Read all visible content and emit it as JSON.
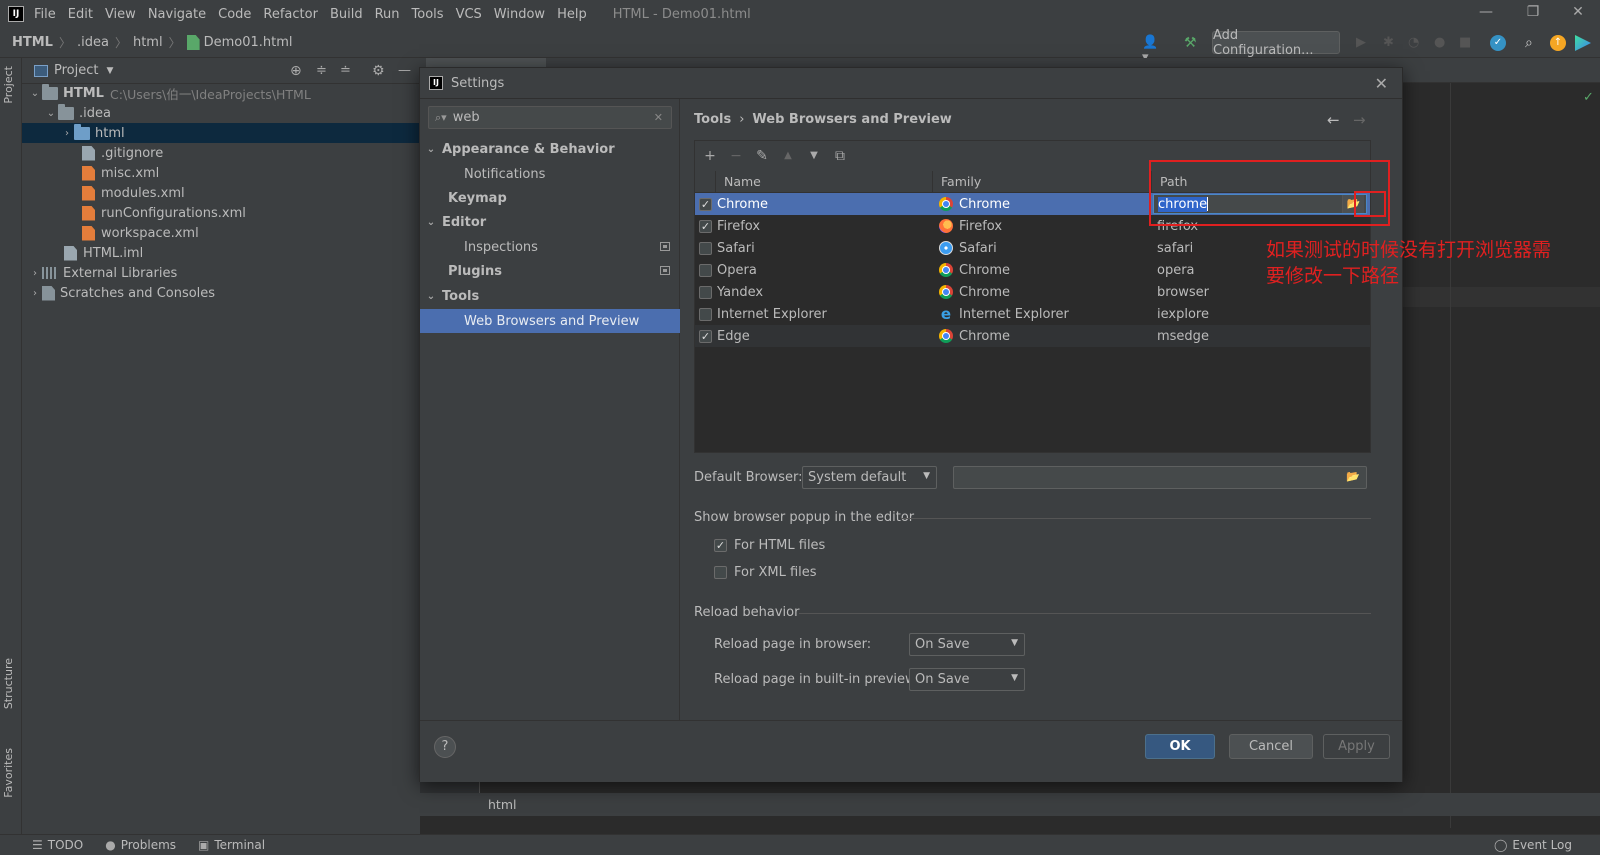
{
  "menubar": {
    "items": [
      "File",
      "Edit",
      "View",
      "Navigate",
      "Code",
      "Refactor",
      "Build",
      "Run",
      "Tools",
      "VCS",
      "Window",
      "Help"
    ],
    "window_title": "HTML - Demo01.html"
  },
  "navbar": {
    "crumbs": [
      "HTML",
      ".idea",
      "html",
      "Demo01.html"
    ],
    "add_config_label": "Add Configuration..."
  },
  "left_stripe": {
    "project_label": "Project",
    "structure_label": "Structure",
    "favorites_label": "Favorites"
  },
  "project_panel": {
    "title": "Project",
    "tree": [
      {
        "label": "HTML",
        "hint": "C:\\Users\\伯一\\IdeaProjects\\HTML"
      },
      {
        "label": ".idea"
      },
      {
        "label": "html"
      },
      {
        "label": ".gitignore"
      },
      {
        "label": "misc.xml"
      },
      {
        "label": "modules.xml"
      },
      {
        "label": "runConfigurations.xml"
      },
      {
        "label": "workspace.xml"
      },
      {
        "label": "HTML.iml"
      },
      {
        "label": "External Libraries"
      },
      {
        "label": "Scratches and Consoles"
      }
    ]
  },
  "editor": {
    "footer_label": "html"
  },
  "statusbar": {
    "todo": "TODO",
    "problems": "Problems",
    "terminal": "Terminal",
    "event_log": "Event Log"
  },
  "dialog": {
    "title": "Settings",
    "search_value": "web",
    "nav": [
      {
        "label": "Appearance & Behavior"
      },
      {
        "label": "Notifications"
      },
      {
        "label": "Keymap"
      },
      {
        "label": "Editor"
      },
      {
        "label": "Inspections"
      },
      {
        "label": "Plugins"
      },
      {
        "label": "Tools"
      },
      {
        "label": "Web Browsers and Preview"
      }
    ],
    "breadcrumb": {
      "parent": "Tools",
      "sep": "›",
      "current": "Web Browsers and Preview"
    },
    "table": {
      "columns": [
        "Name",
        "Family",
        "Path"
      ],
      "rows": [
        {
          "checked": true,
          "name": "Chrome",
          "family": "Chrome",
          "family_icon": "chrome-icon",
          "path": "chrome"
        },
        {
          "checked": true,
          "name": "Firefox",
          "family": "Firefox",
          "family_icon": "firefox-icon",
          "path": "firefox"
        },
        {
          "checked": false,
          "name": "Safari",
          "family": "Safari",
          "family_icon": "safari-icon",
          "path": "safari"
        },
        {
          "checked": false,
          "name": "Opera",
          "family": "Chrome",
          "family_icon": "chrome-icon",
          "path": "opera"
        },
        {
          "checked": false,
          "name": "Yandex",
          "family": "Chrome",
          "family_icon": "chrome-icon",
          "path": "browser"
        },
        {
          "checked": false,
          "name": "Internet Explorer",
          "family": "Internet Explorer",
          "family_icon": "ie-icon",
          "path": "iexplore"
        },
        {
          "checked": true,
          "name": "Edge",
          "family": "Chrome",
          "family_icon": "chrome-icon",
          "path": "msedge"
        }
      ]
    },
    "default_browser": {
      "label": "Default Browser:",
      "value": "System default"
    },
    "popup_group": {
      "title": "Show browser popup in the editor",
      "html_label": "For HTML files",
      "html_checked": true,
      "xml_label": "For XML files",
      "xml_checked": false
    },
    "reload_group": {
      "title": "Reload behavior",
      "browser_label": "Reload page in browser:",
      "browser_value": "On Save",
      "preview_label": "Reload page in built-in preview:",
      "preview_value": "On Save"
    },
    "buttons": {
      "help": "?",
      "ok": "OK",
      "cancel": "Cancel",
      "apply": "Apply"
    }
  },
  "annotation": {
    "text": "如果测试的时候没有打开浏览器需要修改一下路径",
    "color": "#e02020"
  }
}
